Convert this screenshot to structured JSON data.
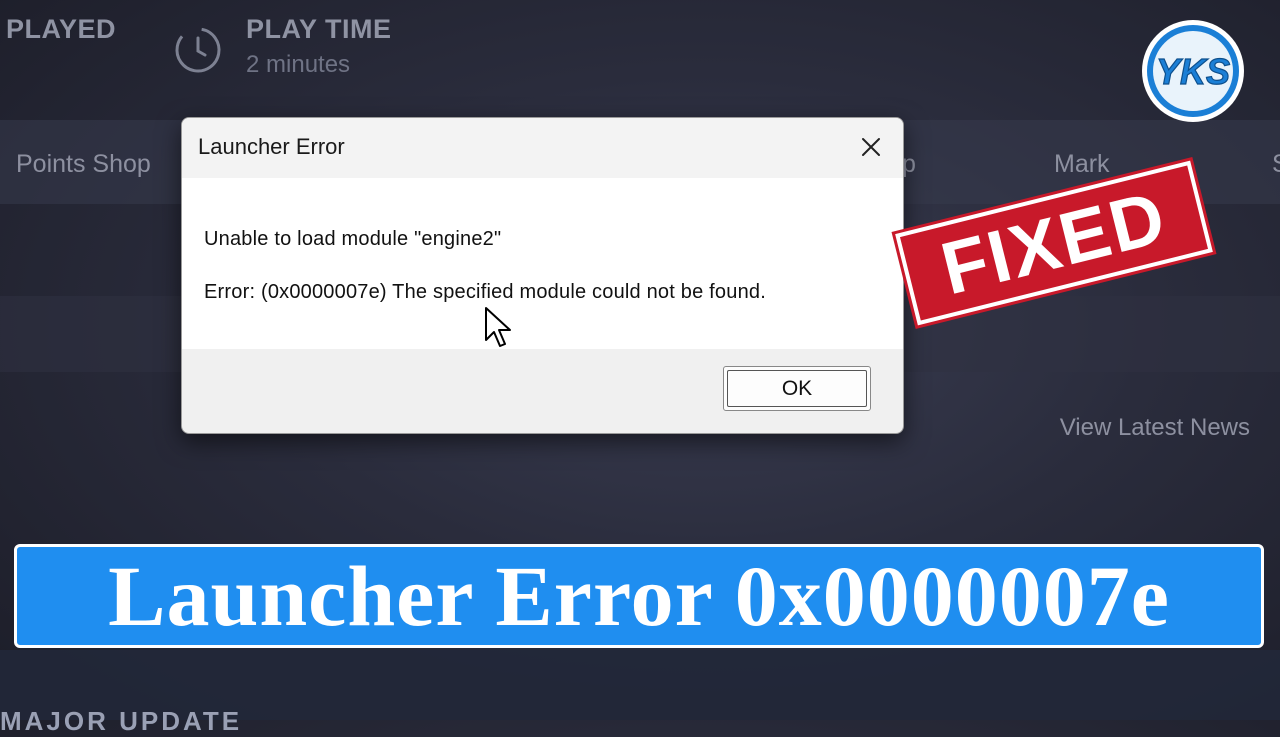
{
  "steam": {
    "played_label": "PLAYED",
    "play_time_label": "PLAY TIME",
    "play_time_value": "2 minutes",
    "nav_items": [
      "Points Shop",
      "p",
      "Mark",
      "S"
    ],
    "view_latest_news": "View Latest News",
    "bottom_text": "MAJOR UPDATE"
  },
  "dialog": {
    "title": "Launcher Error",
    "message_line1": "Unable to load module \"engine2\"",
    "message_line2": "Error: (0x0000007e) The specified module could not be found.",
    "ok_label": "OK",
    "close_icon": "close-icon"
  },
  "stamp": {
    "text": "FIXED",
    "color": "#c8192a"
  },
  "logo": {
    "text": "YKS",
    "color": "#1f8ef0"
  },
  "banner": {
    "text": "Launcher Error 0x0000007e",
    "color": "#1f8ef0"
  }
}
